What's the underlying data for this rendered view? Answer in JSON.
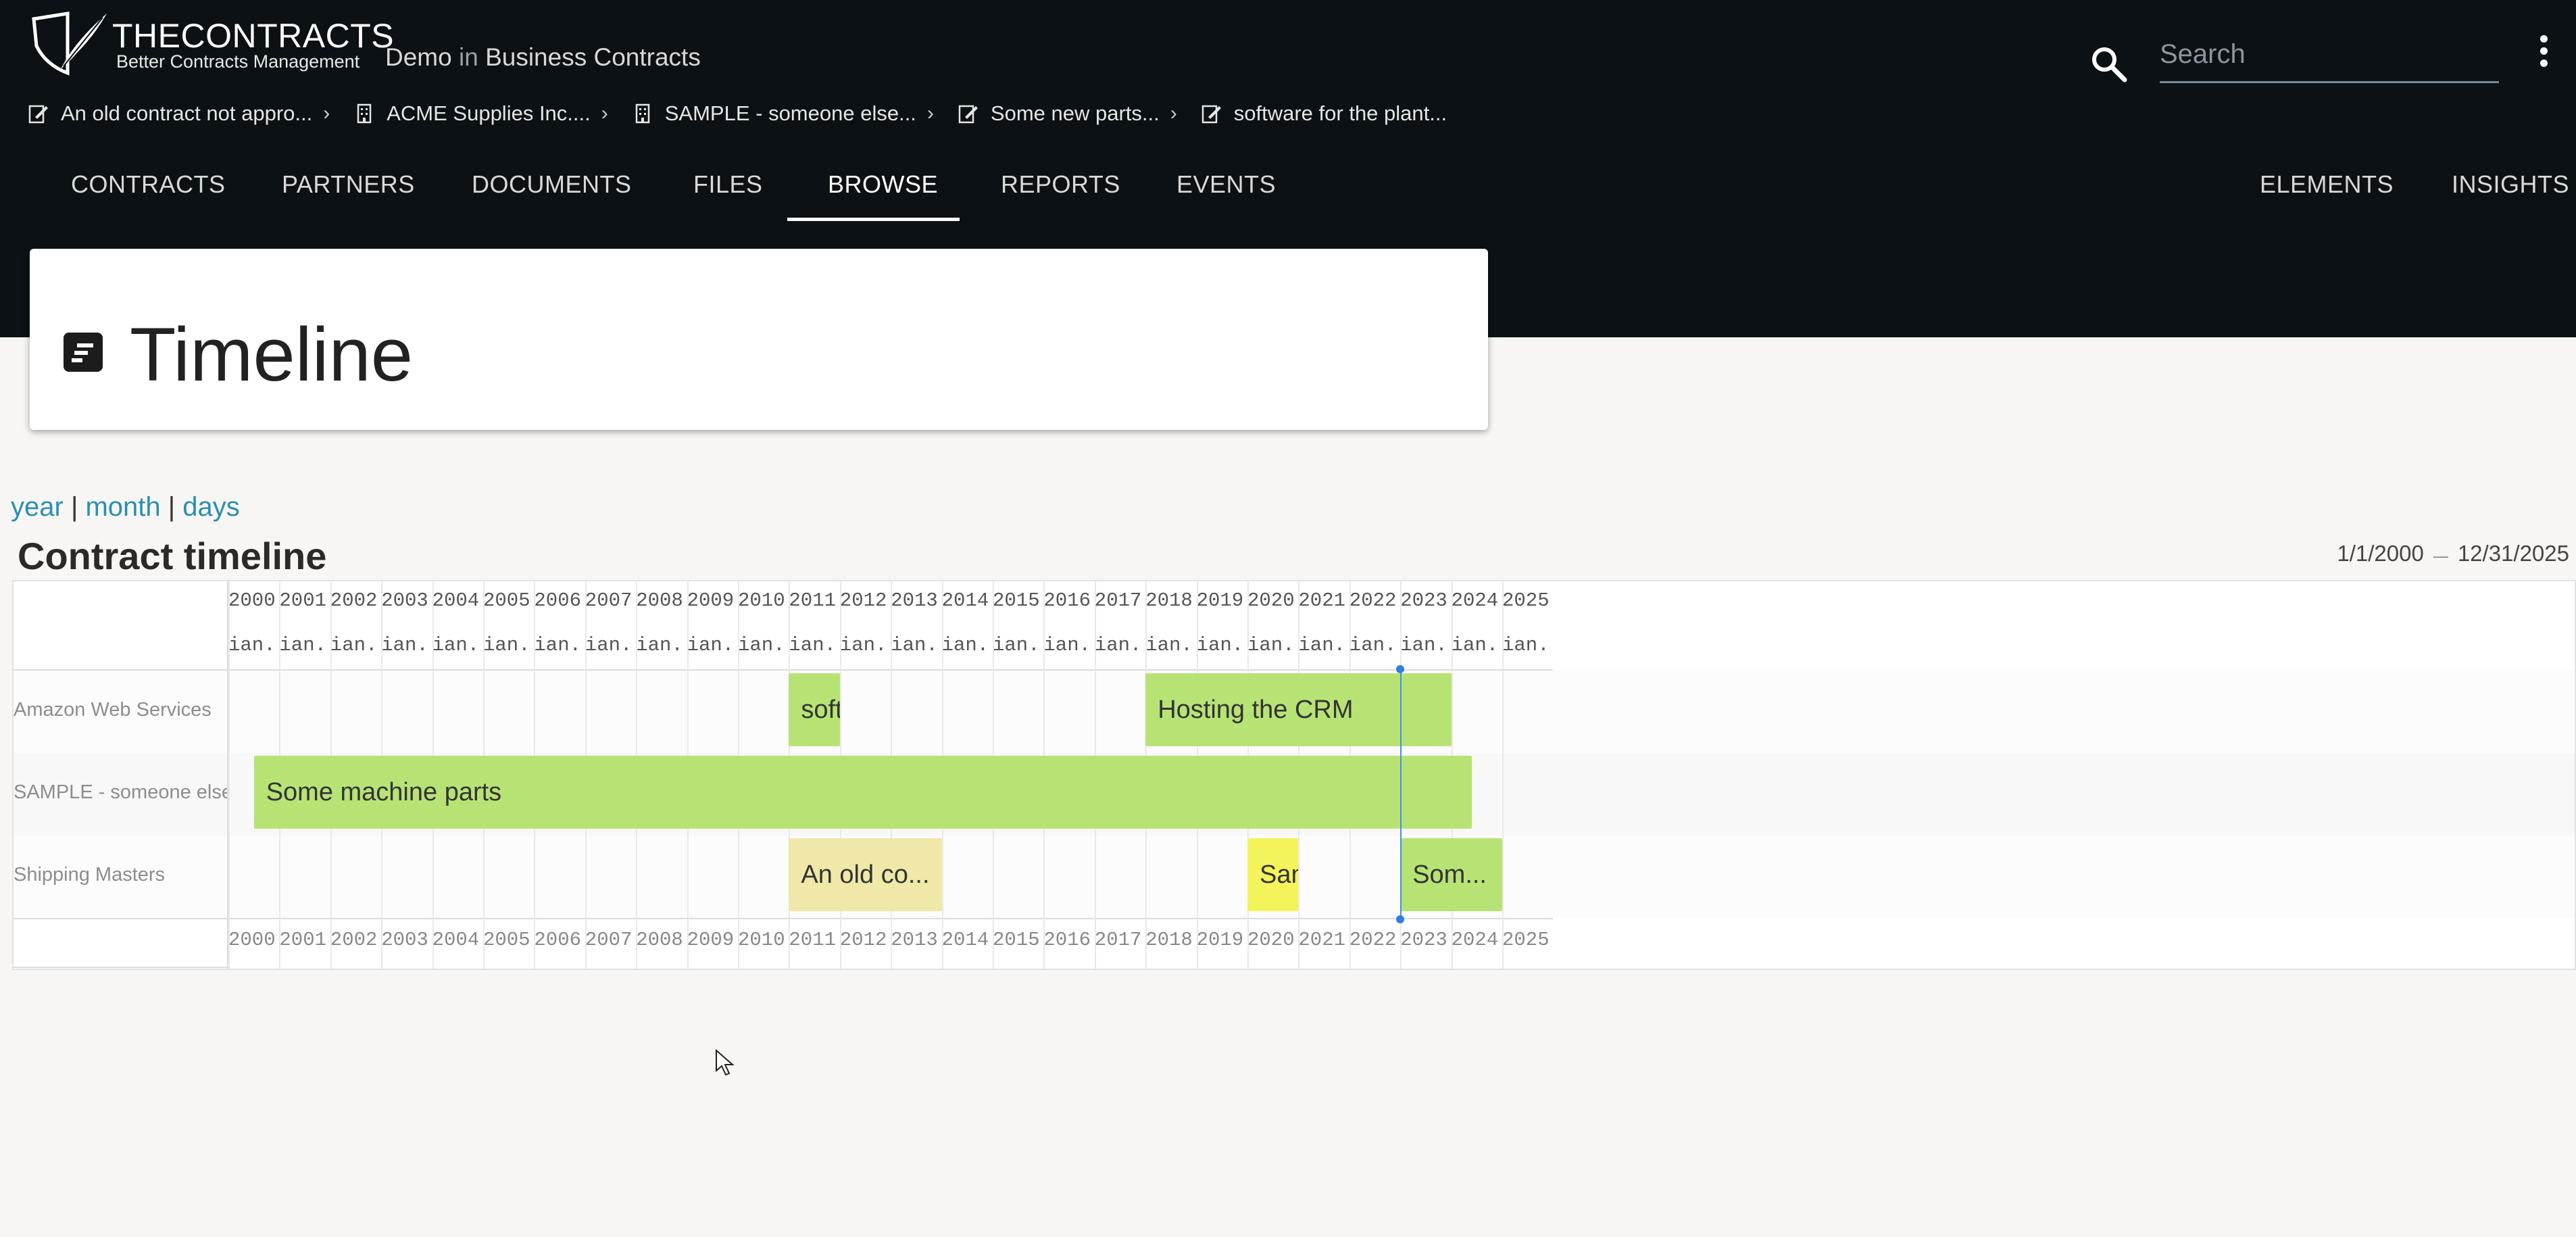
{
  "brand": {
    "name": "THECONTRACTS",
    "tagline": "Better Contracts Management"
  },
  "workspace": {
    "name": "Demo",
    "in": "in",
    "section": "Business Contracts"
  },
  "search": {
    "placeholder": "Search",
    "value": ""
  },
  "breadcrumbs": [
    {
      "label": "An old contract not appro...",
      "icon": "contract-icon"
    },
    {
      "label": "ACME Supplies Inc....",
      "icon": "building-icon"
    },
    {
      "label": "SAMPLE - someone else...",
      "icon": "building-icon"
    },
    {
      "label": "Some new parts...",
      "icon": "contract-icon"
    },
    {
      "label": "software for the plant...",
      "icon": "contract-icon"
    }
  ],
  "nav": {
    "left": [
      "CONTRACTS",
      "PARTNERS",
      "DOCUMENTS",
      "FILES",
      "BROWSE",
      "REPORTS",
      "EVENTS"
    ],
    "right": [
      "ELEMENTS",
      "INSIGHTS"
    ],
    "active": "BROWSE"
  },
  "page": {
    "title": "Timeline"
  },
  "view_links": {
    "year": "year",
    "separator": "|",
    "month": "month",
    "days": "days"
  },
  "timeline": {
    "title": "Contract timeline",
    "range_start": "1/1/2000",
    "range_end": "12/31/2025",
    "range_separator": "—",
    "years": [
      "2000",
      "2001",
      "2002",
      "2003",
      "2004",
      "2005",
      "2006",
      "2007",
      "2008",
      "2009",
      "2010",
      "2011",
      "2012",
      "2013",
      "2014",
      "2015",
      "2016",
      "2017",
      "2018",
      "2019",
      "2020",
      "2021",
      "2022",
      "2023",
      "2024",
      "2025"
    ],
    "month_label": "ian.",
    "today_year": 2023.0,
    "rows": [
      {
        "label": "Amazon Web Services",
        "bars": [
          {
            "text": "soft",
            "start": 2011.0,
            "end": 2012.0,
            "color": "green"
          },
          {
            "text": "Hosting the CRM",
            "start": 2018.0,
            "end": 2024.0,
            "color": "green"
          }
        ]
      },
      {
        "label": "SAMPLE - someone else",
        "bars": [
          {
            "text": "Some machine parts",
            "start": 2000.5,
            "end": 2024.4,
            "color": "green"
          }
        ]
      },
      {
        "label": "Shipping Masters",
        "bars": [
          {
            "text": "An old co...",
            "start": 2011.0,
            "end": 2014.0,
            "color": "khaki"
          },
          {
            "text": "San",
            "start": 2020.0,
            "end": 2021.0,
            "color": "yellow"
          },
          {
            "text": "Som...",
            "start": 2023.0,
            "end": 2025.0,
            "color": "green"
          }
        ]
      }
    ]
  },
  "colors": {
    "header_bg": "#0b1115",
    "link": "#2a8fb3",
    "bar_green": "#b7e375",
    "bar_yellow": "#f5f35b",
    "bar_khaki": "#efe8a8",
    "today_line": "#4a90e2"
  }
}
